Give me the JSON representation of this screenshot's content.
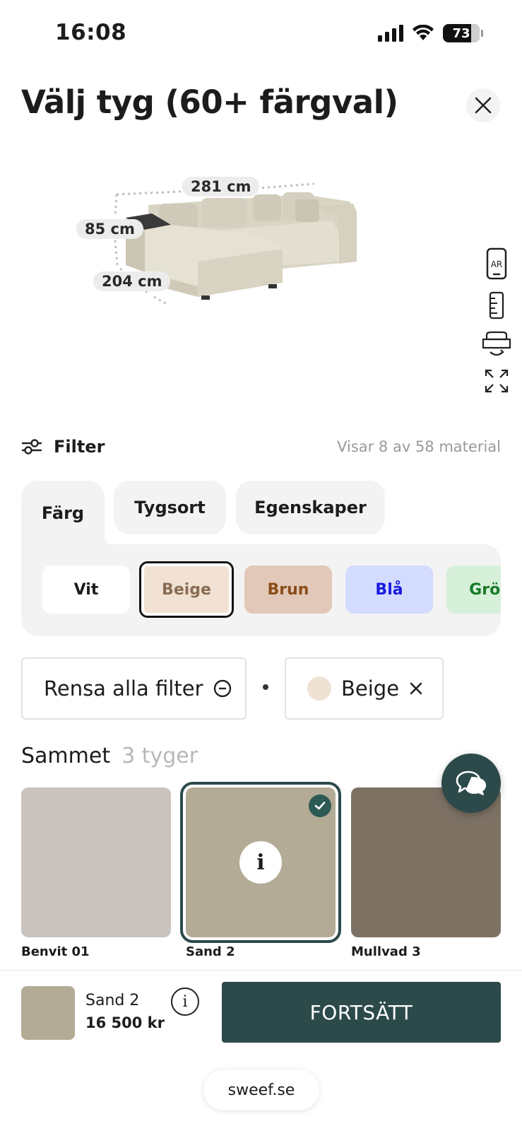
{
  "status_bar": {
    "time": "16:08",
    "battery": "73"
  },
  "header": {
    "title": "Välj tyg (60+ färgval)"
  },
  "preview": {
    "dimensions": {
      "width": "281 cm",
      "height": "85 cm",
      "depth": "204 cm"
    },
    "tools": [
      {
        "icon": "ar-icon",
        "label": "AR"
      },
      {
        "icon": "ruler-icon"
      },
      {
        "icon": "rotate-sofa-icon"
      },
      {
        "icon": "fullscreen-icon"
      }
    ]
  },
  "filter": {
    "label": "Filter",
    "count_text": "Visar 8 av 58 material",
    "tabs": [
      {
        "label": "Färg",
        "active": true
      },
      {
        "label": "Tygsort",
        "active": false
      },
      {
        "label": "Egenskaper",
        "active": false
      }
    ],
    "colors": [
      {
        "label": "Vit",
        "bg": "#ffffff",
        "fg": "#1c1c1c",
        "selected": false
      },
      {
        "label": "Beige",
        "bg": "#f1e2d3",
        "fg": "#8a6c55",
        "selected": true
      },
      {
        "label": "Brun",
        "bg": "#e2c8b8",
        "fg": "#8a4d1a",
        "selected": false
      },
      {
        "label": "Blå",
        "bg": "#d3dcff",
        "fg": "#1a1ae0",
        "selected": false
      },
      {
        "label": "Grön",
        "bg": "#d6f0d9",
        "fg": "#1a7a2a",
        "selected": false
      }
    ],
    "clear_label": "Rensa alla filter",
    "active_filter": {
      "label": "Beige",
      "swatch_color": "#efe2d4"
    }
  },
  "section": {
    "title": "Sammet",
    "count": "3 tyger",
    "fabrics": [
      {
        "name": "Benvit 01",
        "color": "#c8c3bf",
        "selected": false
      },
      {
        "name": "Sand 2",
        "color": "#b3ab95",
        "selected": true
      },
      {
        "name": "Mullvad 3",
        "color": "#7d7164",
        "selected": false
      }
    ]
  },
  "bottom": {
    "selected_name": "Sand 2",
    "price": "16 500 kr",
    "continue_label": "FORTSÄTT",
    "url": "sweef.se"
  },
  "colors": {
    "brand": "#2d4a4a",
    "panel": "#f3f3f3"
  }
}
